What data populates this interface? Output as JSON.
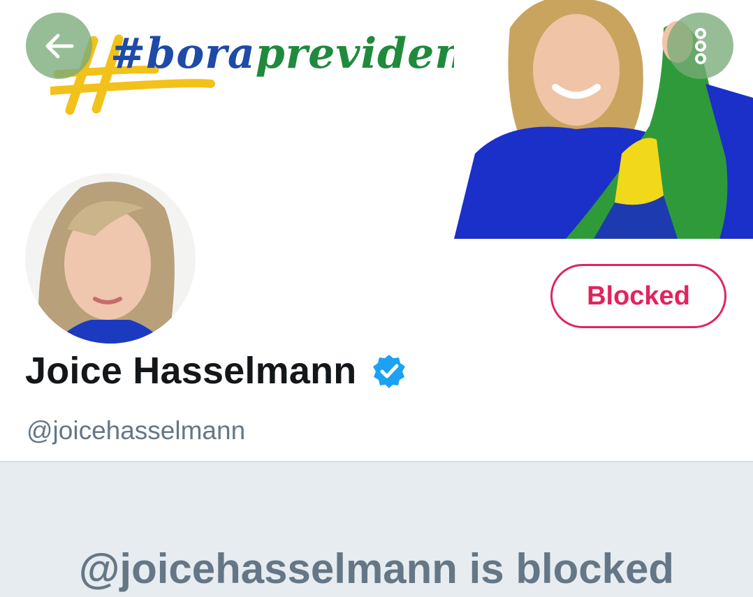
{
  "banner": {
    "hashtag_prefix": "#bora",
    "hashtag_suffix": "previdenciar",
    "hashtag_colors": {
      "yellow": "#f2c21b",
      "blue": "#1e4aa8",
      "green": "#1f8a3c"
    },
    "back_icon": "arrow-left-icon",
    "more_icon": "more-vertical-icon"
  },
  "profile": {
    "display_name": "Joice Hasselmann",
    "handle": "@joicehasselmann",
    "verified": true,
    "blocked_button_label": "Blocked"
  },
  "blocked_notice": {
    "message": "@joicehasselmann is blocked"
  },
  "colors": {
    "blocked_accent": "#e0245e",
    "verified_blue": "#1da1f2",
    "muted_text": "#657786",
    "notice_background": "#e6ecf0"
  }
}
